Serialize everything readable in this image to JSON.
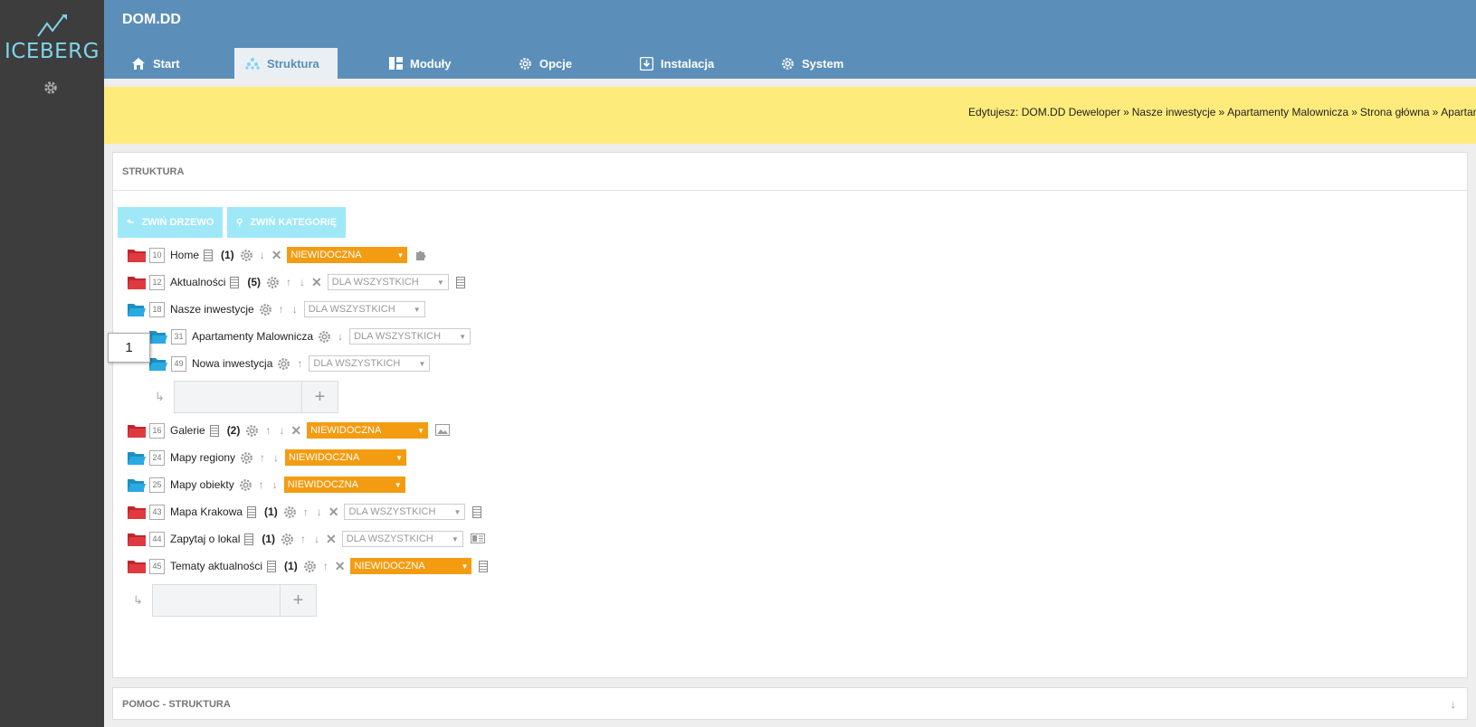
{
  "app": {
    "logo": "ICEBERG",
    "brand": "DOM.DD"
  },
  "colors": {
    "header": "#5b8fb9",
    "sidebar": "#3d3d3d",
    "crumbbar": "#fdec7c",
    "orange": "#f39c12",
    "cyan": "#9ee8f7",
    "folder_red": "#c0262c",
    "folder_blue": "#29abe2"
  },
  "tabs": [
    {
      "label": "Start",
      "icon": "home-icon"
    },
    {
      "label": "Struktura",
      "icon": "sitemap-icon",
      "active": true
    },
    {
      "label": "Moduły",
      "icon": "modules-icon"
    },
    {
      "label": "Opcje",
      "icon": "gear-icon"
    },
    {
      "label": "Instalacja",
      "icon": "install-icon"
    },
    {
      "label": "System",
      "icon": "gear-icon"
    }
  ],
  "breadcrumb": {
    "prefix": "Edytujesz:",
    "items": [
      "DOM.DD Deweloper",
      "Nasze inwestycje",
      "Apartamenty Malownicza",
      "Strona główna",
      "Apartamenty Malownicza"
    ],
    "separator": "»"
  },
  "panel": {
    "title": "STRUKTURA",
    "collapse_tree": "ZWIŃ DRZEWO",
    "collapse_category": "ZWIŃ KATEGORIĘ"
  },
  "tree": [
    {
      "id": "10",
      "name": "Home",
      "count": "(1)",
      "visibility": "NIEWIDOCZNA"
    },
    {
      "id": "12",
      "name": "Aktualności",
      "count": "(5)",
      "visibility": "DLA WSZYSTKICH"
    },
    {
      "id": "18",
      "name": "Nasze inwestycje",
      "visibility": "DLA WSZYSTKICH"
    },
    {
      "id": "31",
      "name": "Apartamenty Malownicza",
      "visibility": "DLA WSZYSTKICH"
    },
    {
      "id": "49",
      "name": "Nowa inwestycja",
      "visibility": "DLA WSZYSTKICH"
    },
    {
      "id": "16",
      "name": "Galerie",
      "count": "(2)",
      "visibility": "NIEWIDOCZNA"
    },
    {
      "id": "24",
      "name": "Mapy regiony",
      "visibility": "NIEWIDOCZNA"
    },
    {
      "id": "25",
      "name": "Mapy obiekty",
      "visibility": "NIEWIDOCZNA"
    },
    {
      "id": "43",
      "name": "Mapa Krakowa",
      "count": "(1)",
      "visibility": "DLA WSZYSTKICH"
    },
    {
      "id": "44",
      "name": "Zapytaj o lokal",
      "count": "(1)",
      "visibility": "DLA WSZYSTKICH"
    },
    {
      "id": "45",
      "name": "Tematy aktualności",
      "count": "(1)",
      "visibility": "NIEWIDOCZNA"
    }
  ],
  "marker": "1",
  "help": {
    "title": "POMOC - STRUKTURA"
  }
}
